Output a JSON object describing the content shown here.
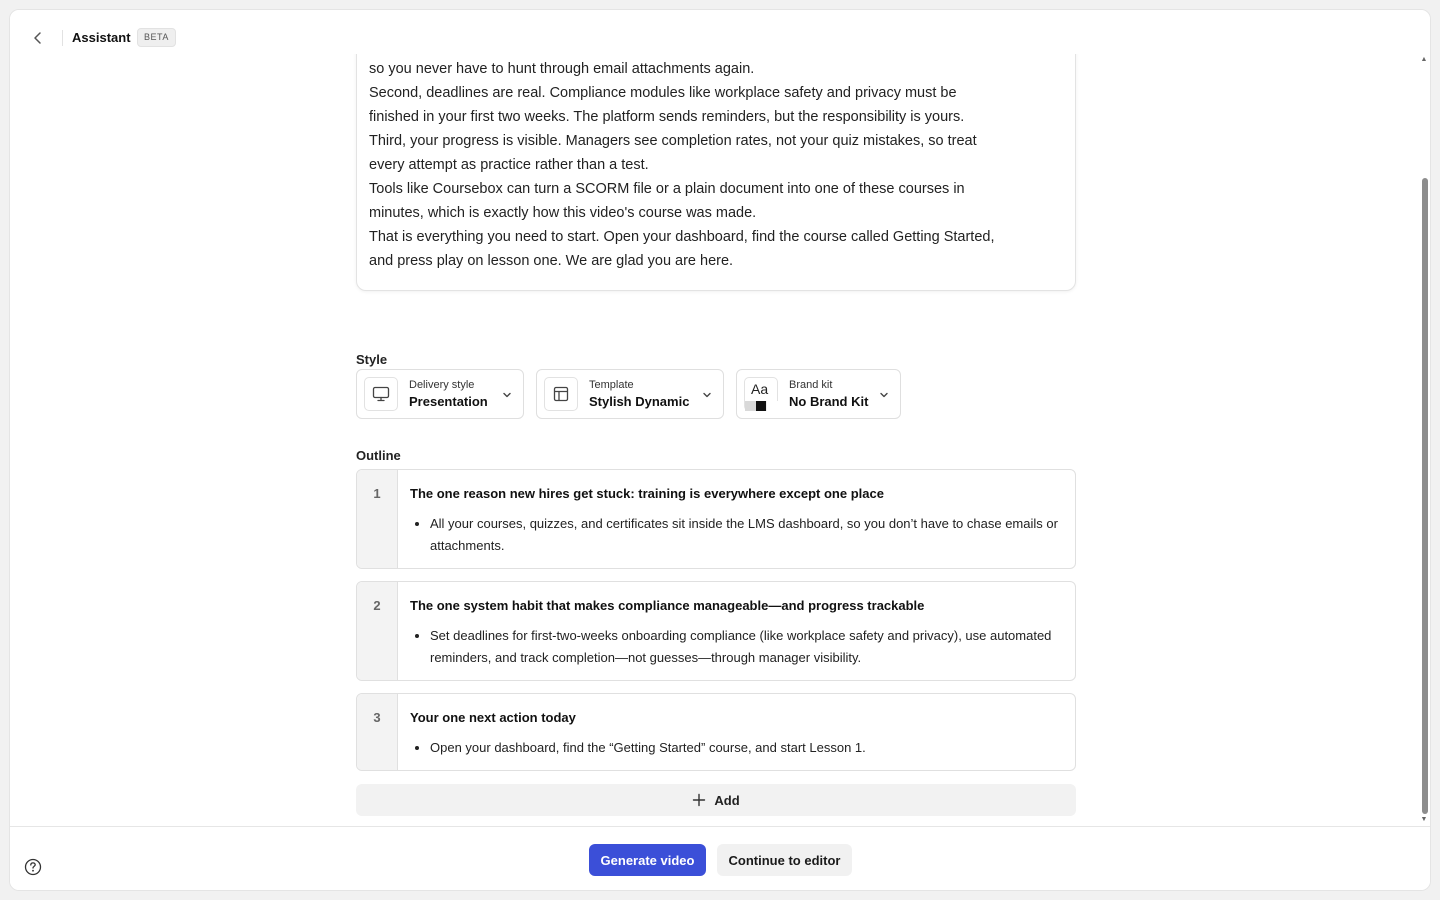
{
  "header": {
    "title": "Assistant",
    "badge": "BETA"
  },
  "script": {
    "paragraphs": [
      "so you never have to hunt through email attachments again.",
      "Second, deadlines are real. Compliance modules like workplace safety and privacy must be finished in your first two weeks. The platform sends reminders, but the responsibility is yours.",
      "Third, your progress is visible. Managers see completion rates, not your quiz mistakes, so treat every attempt as practice rather than a test.",
      "Tools like Coursebox can turn a SCORM file or a plain document into one of these courses in minutes, which is exactly how this video's course was made.",
      "That is everything you need to start. Open your dashboard, find the course called Getting Started, and press play on lesson one. We are glad you are here."
    ]
  },
  "style": {
    "label": "Style",
    "delivery": {
      "caption": "Delivery style",
      "value": "Presentation",
      "icon": "monitor-icon"
    },
    "template": {
      "caption": "Template",
      "value": "Stylish Dynamic",
      "icon": "layout-icon"
    },
    "brand": {
      "caption": "Brand kit",
      "value": "No Brand Kit",
      "icon_text": "Aa"
    }
  },
  "outline": {
    "label": "Outline",
    "items": [
      {
        "num": "1",
        "title": "The one reason new hires get stuck: training is everywhere except one place",
        "bullet": "All your courses, quizzes, and certificates sit inside the LMS dashboard, so you don’t have to chase emails or attachments."
      },
      {
        "num": "2",
        "title": "The one system habit that makes compliance manageable—and progress trackable",
        "bullet": "Set deadlines for first-two-weeks onboarding compliance (like workplace safety and privacy), use automated reminders, and track completion—not guesses—through manager visibility."
      },
      {
        "num": "3",
        "title": "Your one next action today",
        "bullet": "Open your dashboard, find the “Getting Started” course, and start Lesson 1."
      }
    ],
    "add_label": "Add"
  },
  "footer": {
    "generate_label": "Generate video",
    "continue_label": "Continue to editor"
  },
  "colors": {
    "primary": "#3b4fd8"
  }
}
